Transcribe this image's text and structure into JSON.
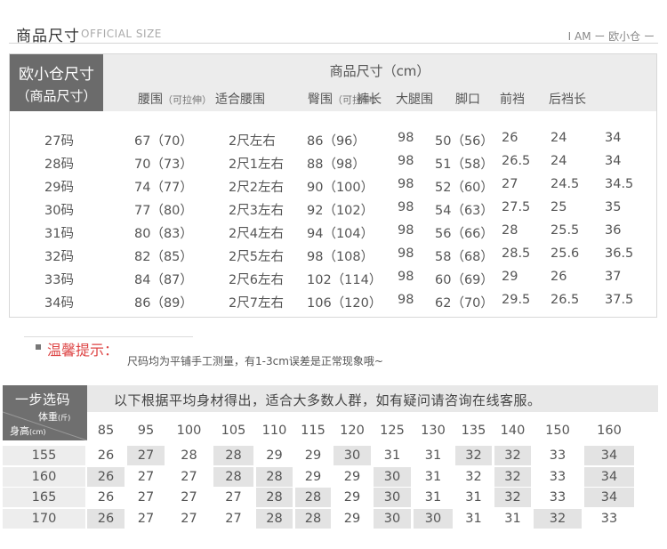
{
  "header": {
    "title": "商品尺寸",
    "subtitle": "OFFICIAL SIZE",
    "brand": "I AM ー 欧小仓 ー"
  },
  "size_table": {
    "corner_line1": "欧小仓尺寸",
    "corner_line2": "（商品尺寸）",
    "title": "商品尺寸（cm）",
    "columns": [
      {
        "label": "腰围",
        "note": "（可拉伸）"
      },
      {
        "label": "适合腰围",
        "note": ""
      },
      {
        "label": "臀围",
        "note": "（可拉伸）"
      },
      {
        "label": "裤长",
        "note": ""
      },
      {
        "label": "大腿围",
        "note": ""
      },
      {
        "label": "脚口",
        "note": ""
      },
      {
        "label": "前裆",
        "note": ""
      },
      {
        "label": "后裆长",
        "note": ""
      }
    ],
    "rows": [
      [
        "27码",
        "67（70）",
        "2尺左右",
        "86（96）",
        "98",
        "50（56）",
        "26",
        "24",
        "34"
      ],
      [
        "28码",
        "70（73）",
        "2尺1左右",
        "88（98）",
        "98",
        "51（58）",
        "26.5",
        "24",
        "34"
      ],
      [
        "29码",
        "74（77）",
        "2尺2左右",
        "90（100）",
        "98",
        "52（60）",
        "27",
        "24.5",
        "34.5"
      ],
      [
        "30码",
        "77（80）",
        "2尺3左右",
        "92（102）",
        "98",
        "54（63）",
        "27.5",
        "25",
        "35"
      ],
      [
        "31码",
        "80（83）",
        "2尺4左右",
        "94（104）",
        "98",
        "56（66）",
        "28",
        "25.5",
        "36"
      ],
      [
        "32码",
        "82（85）",
        "2尺5左右",
        "98（108）",
        "98",
        "58（68）",
        "28.5",
        "25.6",
        "36.5"
      ],
      [
        "33码",
        "84（87）",
        "2尺6左右",
        "102（114）",
        "98",
        "60（69）",
        "29",
        "26",
        "37"
      ],
      [
        "34码",
        "86（89）",
        "2尺7左右",
        "106（120）",
        "98",
        "62（70）",
        "29.5",
        "26.5",
        "37.5"
      ]
    ]
  },
  "tip": {
    "label": "温馨提示：",
    "text": "尺码均为平铺手工测量，有1-3cm误差是正常现象哦~"
  },
  "recommend": {
    "corner_title": "一步选码",
    "weight_label": "体重",
    "weight_unit": "(斤)",
    "height_label": "身高",
    "height_unit": "(cm)",
    "banner": "以下根据平均身材得出，适合大多数人群，如有疑问请咨询在线客服。",
    "weights": [
      "85",
      "95",
      "100",
      "105",
      "110",
      "115",
      "120",
      "125",
      "130",
      "135",
      "140",
      "150",
      "160"
    ],
    "heights": [
      "155",
      "160",
      "165",
      "170"
    ],
    "rows": [
      [
        "26",
        "27",
        "28",
        "28",
        "29",
        "29",
        "30",
        "31",
        "31",
        "32",
        "32",
        "33",
        "34"
      ],
      [
        "26",
        "27",
        "27",
        "28",
        "28",
        "29",
        "29",
        "30",
        "31",
        "32",
        "32",
        "33",
        "34"
      ],
      [
        "26",
        "27",
        "27",
        "27",
        "28",
        "28",
        "29",
        "30",
        "31",
        "31",
        "32",
        "33",
        "34"
      ],
      [
        "26",
        "27",
        "27",
        "27",
        "28",
        "28",
        "29",
        "30",
        "30",
        "31",
        "31",
        "32",
        "33"
      ]
    ]
  }
}
